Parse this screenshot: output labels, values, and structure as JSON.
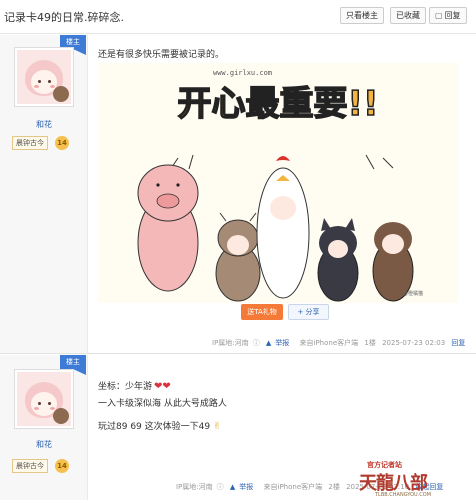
{
  "thread": {
    "title": "记录卡49的日常.碎碎念."
  },
  "toolbar": {
    "only_author": "只看楼主",
    "favorited": "已收藏",
    "reply": "回复"
  },
  "posts": [
    {
      "badge": "楼主",
      "username": "和花",
      "rank": "晨钟古今",
      "level": "14",
      "text": "还是有很多快乐需要被记录的。",
      "image": {
        "site": "www.girlxu.com",
        "headline": "开心最重要!!",
        "signature": "@橙橘猫"
      },
      "buttons": {
        "gift": "送TA礼物",
        "share": "分享"
      },
      "footer": {
        "ip": "IP属地:河南",
        "report": "举报",
        "client": "来自iPhone客户端",
        "floor": "1楼",
        "time": "2025-07-23 02:03",
        "reply": "回复"
      }
    },
    {
      "badge": "楼主",
      "username": "和花",
      "rank": "晨钟古今",
      "level": "14",
      "lines": [
        "坐标：少年游",
        "一入卡级深似海 从此大号成路人",
        "玩过89 69 这次体验一下49"
      ],
      "footer": {
        "ip": "IP属地:河南",
        "report": "举报",
        "client": "来自iPhone客户端",
        "floor": "2楼",
        "time": "2025-07-23 02:10",
        "reply": "收起回复"
      }
    }
  ],
  "watermark": {
    "title": "官方记者站",
    "main": "天龍八部",
    "url": "TLBB.CHANGYOU.COM"
  }
}
